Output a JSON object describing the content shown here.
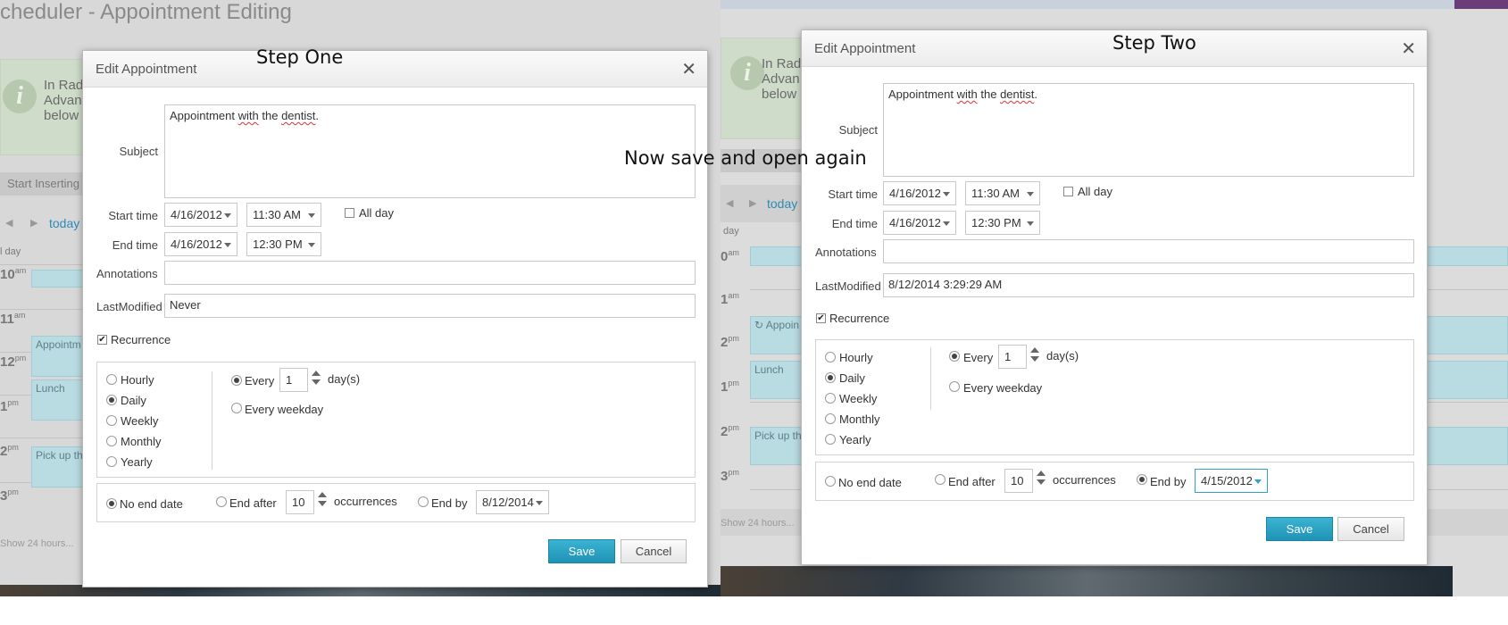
{
  "background": {
    "app_title": "cheduler - Appointment Editing",
    "info_text_left": "In Rad\nAdvan\nbelow",
    "info_text_right": "In Rad\nAdvan\nbelow",
    "toolbar_text": "Start Inserting",
    "today_label": "today",
    "allday_label": "l day",
    "day_label": "day",
    "hours_left": [
      {
        "h": "10",
        "s": "am"
      },
      {
        "h": "11",
        "s": "am"
      },
      {
        "h": "12",
        "s": "pm"
      },
      {
        "h": "1",
        "s": "pm"
      },
      {
        "h": "2",
        "s": "pm"
      },
      {
        "h": "3",
        "s": "pm"
      }
    ],
    "hours_right": [
      {
        "h": "0",
        "s": "am"
      },
      {
        "h": "1",
        "s": "am"
      },
      {
        "h": "2",
        "s": "pm"
      },
      {
        "h": "1",
        "s": "pm"
      },
      {
        "h": "2",
        "s": "pm"
      },
      {
        "h": "3",
        "s": "pm"
      }
    ],
    "appt_left": [
      "Appointm",
      "Lunch",
      "Pick up th"
    ],
    "appt_right": [
      "Appoin",
      "Lunch",
      "Pick up th"
    ],
    "show24": "Show 24 hours..."
  },
  "note": "Now save and open again",
  "step_one": {
    "step_label": "Step One",
    "title": "Edit Appointment",
    "close": "✕",
    "labels": {
      "subject": "Subject",
      "start_time": "Start time",
      "end_time": "End time",
      "annotations": "Annotations",
      "last_modified": "LastModified",
      "recurrence": "Recurrence",
      "all_day": "All day"
    },
    "subject_words": [
      "Appointment",
      "with",
      "the",
      "dentist",
      "."
    ],
    "start_date": "4/16/2012",
    "start_time": "11:30 AM",
    "end_date": "4/16/2012",
    "end_time": "12:30 PM",
    "annotations": "",
    "last_modified": "Never",
    "frequency": [
      "Hourly",
      "Daily",
      "Weekly",
      "Monthly",
      "Yearly"
    ],
    "frequency_selected": "Daily",
    "every_label": "Every",
    "every_value": "1",
    "days_label": "day(s)",
    "every_weekday": "Every weekday",
    "no_end_date": "No end date",
    "end_after": "End after",
    "occurrences_value": "10",
    "occurrences_label": "occurrences",
    "end_by": "End by",
    "end_by_date": "8/12/2014",
    "range_selected": "No end date",
    "save": "Save",
    "cancel": "Cancel"
  },
  "step_two": {
    "step_label": "Step Two",
    "title": "Edit Appointment",
    "close": "✕",
    "labels": {
      "subject": "Subject",
      "start_time": "Start time",
      "end_time": "End time",
      "annotations": "Annotations",
      "last_modified": "LastModified",
      "recurrence": "Recurrence",
      "all_day": "All day"
    },
    "subject_words": [
      "Appointment",
      "with",
      "the",
      "dentist",
      "."
    ],
    "start_date": "4/16/2012",
    "start_time": "11:30 AM",
    "end_date": "4/16/2012",
    "end_time": "12:30 PM",
    "annotations": "",
    "last_modified": "8/12/2014 3:29:29 AM",
    "frequency": [
      "Hourly",
      "Daily",
      "Weekly",
      "Monthly",
      "Yearly"
    ],
    "frequency_selected": "Daily",
    "every_label": "Every",
    "every_value": "1",
    "days_label": "day(s)",
    "every_weekday": "Every weekday",
    "no_end_date": "No end date",
    "end_after": "End after",
    "occurrences_value": "10",
    "occurrences_label": "occurrences",
    "end_by": "End by",
    "end_by_date": "4/15/2012",
    "range_selected": "End by",
    "save": "Save",
    "cancel": "Cancel"
  }
}
